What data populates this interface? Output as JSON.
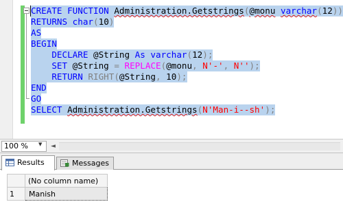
{
  "editor": {
    "lines": [
      [
        {
          "t": "CREATE FUNCTION ",
          "c": "kw"
        },
        {
          "t": "Administration.Getstrings",
          "c": "sq"
        },
        {
          "t": "(",
          "c": "gr"
        },
        {
          "t": "@monu",
          "c": "sq"
        },
        {
          "t": " ",
          "c": ""
        },
        {
          "t": "varchar",
          "c": "kw sq"
        },
        {
          "t": "(",
          "c": "gr"
        },
        {
          "t": "12",
          "c": ""
        },
        {
          "t": "))",
          "c": "gr"
        }
      ],
      [
        {
          "t": "RETURNS ",
          "c": "kw"
        },
        {
          "t": "char",
          "c": "kw"
        },
        {
          "t": "(",
          "c": "gr"
        },
        {
          "t": "10",
          "c": ""
        },
        {
          "t": ")",
          "c": "gr"
        }
      ],
      [
        {
          "t": "AS",
          "c": "kw"
        }
      ],
      [
        {
          "t": "BEGIN",
          "c": "kw"
        }
      ],
      [
        {
          "t": "    DECLARE ",
          "c": "kw"
        },
        {
          "t": "@String ",
          "c": ""
        },
        {
          "t": "As ",
          "c": "kw"
        },
        {
          "t": "varchar",
          "c": "kw"
        },
        {
          "t": "(",
          "c": "gr"
        },
        {
          "t": "12",
          "c": ""
        },
        {
          "t": ");",
          "c": "gr"
        }
      ],
      [
        {
          "t": "    SET ",
          "c": "kw"
        },
        {
          "t": "@String ",
          "c": ""
        },
        {
          "t": "= ",
          "c": "gr"
        },
        {
          "t": "REPLACE",
          "c": "fn"
        },
        {
          "t": "(",
          "c": "gr"
        },
        {
          "t": "@monu",
          "c": ""
        },
        {
          "t": ", ",
          "c": "gr"
        },
        {
          "t": "N'-'",
          "c": "str"
        },
        {
          "t": ", ",
          "c": "gr"
        },
        {
          "t": "N''",
          "c": "str"
        },
        {
          "t": ");",
          "c": "gr"
        }
      ],
      [
        {
          "t": "    RETURN ",
          "c": "kw"
        },
        {
          "t": "RIGHT",
          "c": "gr"
        },
        {
          "t": "(",
          "c": "gr"
        },
        {
          "t": "@String",
          "c": ""
        },
        {
          "t": ", ",
          "c": "gr"
        },
        {
          "t": "10",
          "c": ""
        },
        {
          "t": ");",
          "c": "gr"
        }
      ],
      [
        {
          "t": "END",
          "c": "kw"
        }
      ],
      [
        {
          "t": "GO",
          "c": "kw"
        }
      ],
      [
        {
          "t": "SELECT ",
          "c": "kw"
        },
        {
          "t": "Administration.Getstrings",
          "c": "sq"
        },
        {
          "t": "(",
          "c": "gr"
        },
        {
          "t": "N'Man-i--sh'",
          "c": "str"
        },
        {
          "t": ");",
          "c": "gr"
        }
      ]
    ]
  },
  "zoom": {
    "value": "100 %",
    "arrow": "▼",
    "scroll_left": "◄"
  },
  "results": {
    "tabs": [
      {
        "label": "Results"
      },
      {
        "label": "Messages"
      }
    ],
    "grid": {
      "columns": [
        "(No column name)"
      ],
      "rows": [
        {
          "num": "1",
          "cells": [
            "Manish"
          ]
        }
      ]
    }
  },
  "colors": {
    "selection": "#b9d3ee",
    "keyword": "#0000ff",
    "function": "#ff00ff",
    "string": "#ff0000",
    "operator": "#808080",
    "change_bar": "#6fd26b"
  }
}
